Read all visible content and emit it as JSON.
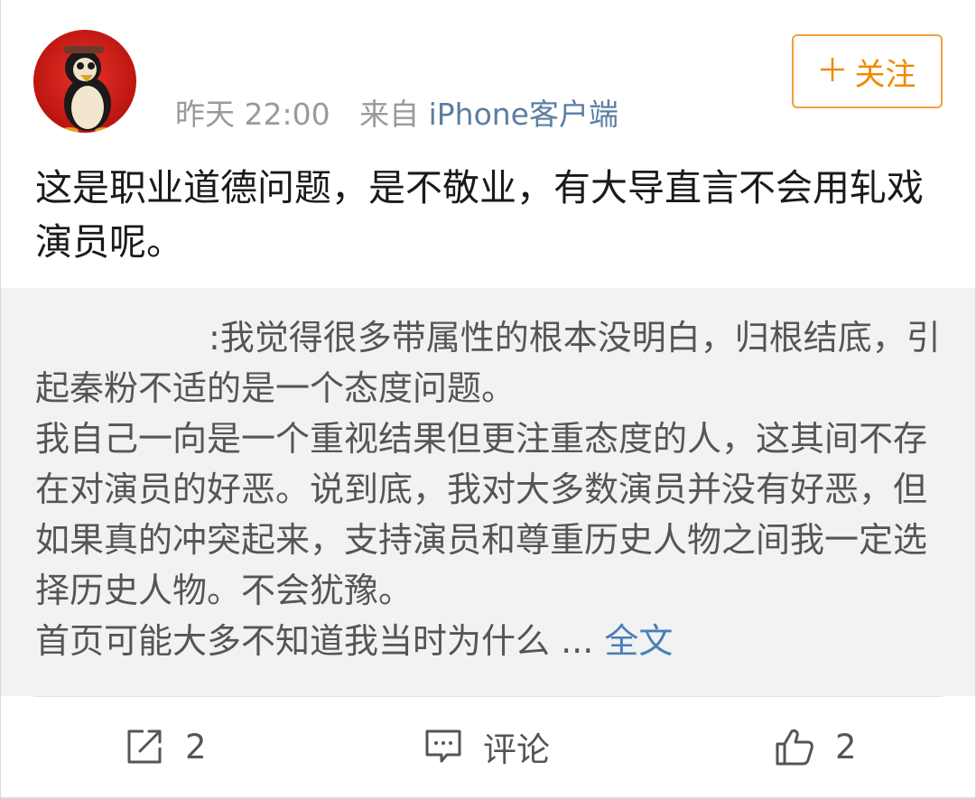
{
  "post": {
    "time": "昨天 22:00",
    "source_prefix": "来自",
    "source_name": "iPhone客户端",
    "follow_label": "关注",
    "text": "这是职业道德问题，是不敬业，有大导直言不会用轧戏演员呢。"
  },
  "repost": {
    "lines": [
      ":我觉得很多带属性的根本没明白，归根结底，引起秦粉不适的是一个态度问题。",
      "我自己一向是一个重视结果但更注重态度的人，这其间不存在对演员的好恶。说到底，我对大多数演员并没有好恶，但如果真的冲突起来，支持演员和尊重历史人物之间我一定选择历史人物。不会犹豫。",
      "首页可能大多不知道我当时为什么 ..."
    ],
    "fulltext_link": "全文"
  },
  "actions": {
    "share_count": "2",
    "comment_label": "评论",
    "like_count": "2"
  },
  "colors": {
    "accent_orange": "#f08a00",
    "link_blue": "#4a7fb8",
    "repost_bg": "#f2f2f2"
  }
}
